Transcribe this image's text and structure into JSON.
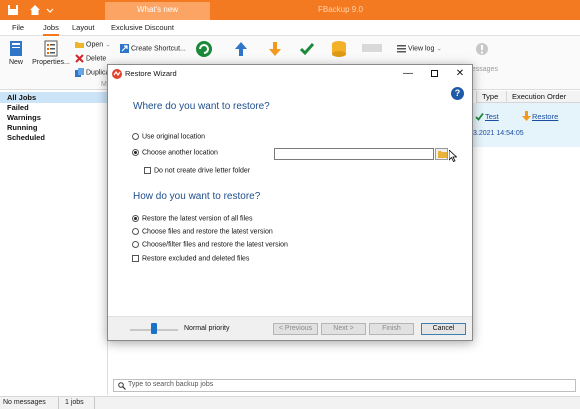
{
  "app": {
    "title": "FBackup 9.0",
    "whats_new_tab": "What's new"
  },
  "menu": {
    "items": [
      "File",
      "Jobs",
      "Layout",
      "Exclusive Discount"
    ],
    "active": "Jobs"
  },
  "ribbon": {
    "new_label": "New",
    "properties_label": "Properties...",
    "open_label": "Open",
    "delete_label": "Delete",
    "duplicate_label": "Duplica",
    "group_label": "M",
    "create_shortcut_label": "Create Shortcut...",
    "view_log_label": "View log",
    "messages_label": "Messages"
  },
  "sidebar": {
    "items": [
      "All Jobs",
      "Failed",
      "Warnings",
      "Running",
      "Scheduled"
    ],
    "selected": "All Jobs"
  },
  "jobs_table": {
    "columns": [
      "Type",
      "Execution Order"
    ],
    "row": {
      "type": "Test",
      "execution_order": "Restore",
      "date_partial": "3.2021 14:54:05"
    }
  },
  "search": {
    "placeholder": "Type to search backup jobs"
  },
  "status": {
    "messages": "No messages",
    "jobs": "1 jobs"
  },
  "dialog": {
    "title": "Restore Wizard",
    "heading_where": "Where do you want to restore?",
    "option_original": "Use original location",
    "option_another": "Choose another location",
    "another_selected": true,
    "location_value": "",
    "no_drive_letter": "Do not create drive letter folder",
    "heading_how": "How do you want to restore?",
    "how_options": [
      "Restore the latest version of all files",
      "Choose files and restore the latest version",
      "Choose/filter files and restore the latest version"
    ],
    "how_selected_index": 0,
    "restore_excluded": "Restore excluded and deleted files",
    "priority_label": "Normal priority",
    "priority_level": 0.5,
    "buttons": {
      "previous": "< Previous",
      "next": "Next >",
      "finish": "Finish",
      "cancel": "Cancel"
    }
  },
  "colors": {
    "brand_orange": "#f47a21",
    "heading_blue": "#1e4e8c",
    "selection_blue": "#cce4f7",
    "check_green": "#1a8a3a"
  }
}
